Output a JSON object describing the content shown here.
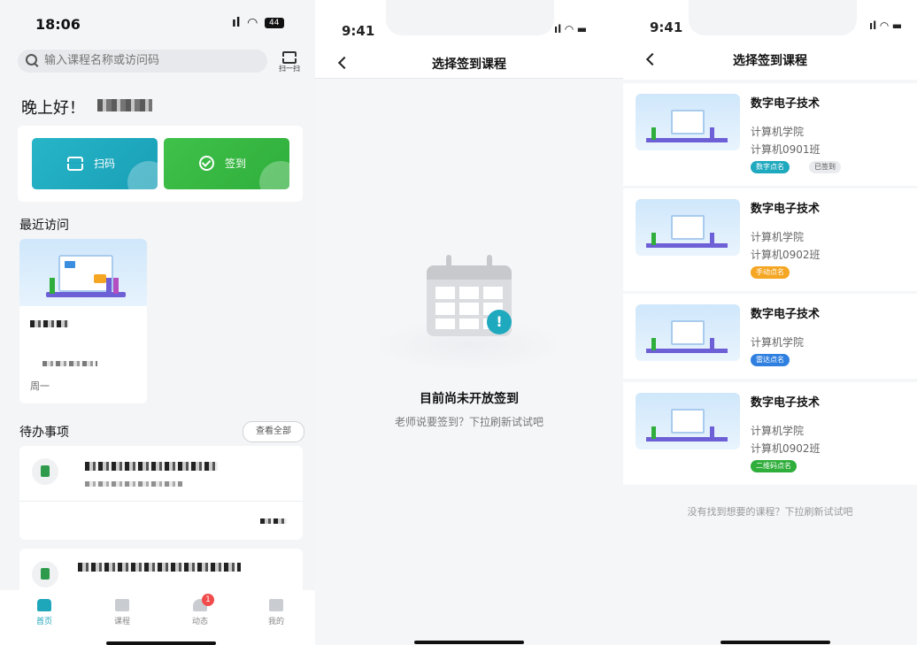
{
  "screen1": {
    "status": {
      "time": "18:06",
      "signal": "ıl",
      "battery": "44"
    },
    "search": {
      "placeholder": "输入课程名称或访问码"
    },
    "scan_top_label": "扫一扫",
    "greeting": "晚上好！",
    "actions": {
      "scan": "扫码",
      "sign": "签到"
    },
    "recent_title": "最近访问",
    "recent_card": {
      "weekday": "周一"
    },
    "todo_title": "待办事项",
    "view_all": "查看全部",
    "tabs": [
      {
        "label": "首页",
        "icon": "home-icon"
      },
      {
        "label": "课程",
        "icon": "book-icon"
      },
      {
        "label": "动态",
        "icon": "bell-icon",
        "badge": "1"
      },
      {
        "label": "我的",
        "icon": "profile-icon"
      }
    ],
    "colors": {
      "teal": "#1ea6bb",
      "green": "#3cba47"
    }
  },
  "screen2": {
    "status": {
      "time": "9:41"
    },
    "nav_title": "选择签到课程",
    "empty_title": "目前尚未开放签到",
    "empty_sub": "老师说要签到？下拉刷新试试吧",
    "alert_mark": "!"
  },
  "screen3": {
    "status": {
      "time": "9:41"
    },
    "nav_title": "选择签到课程",
    "courses": [
      {
        "title": "数字电子技术",
        "school": "计算机学院",
        "class": "计算机0901班",
        "tag": "数字点名",
        "tag_color": "#1fa9be",
        "status": "已签到"
      },
      {
        "title": "数字电子技术",
        "school": "计算机学院",
        "class": "计算机0902班",
        "tag": "手动点名",
        "tag_color": "#f5a623"
      },
      {
        "title": "数字电子技术",
        "school": "计算机学院",
        "tag": "雷达点名",
        "tag_color": "#2f7fe0"
      },
      {
        "title": "数字电子技术",
        "school": "计算机学院",
        "class": "计算机0902班",
        "tag": "二维码点名",
        "tag_color": "#2fae3b"
      }
    ],
    "footer_hint": "没有找到想要的课程？下拉刷新试试吧"
  }
}
